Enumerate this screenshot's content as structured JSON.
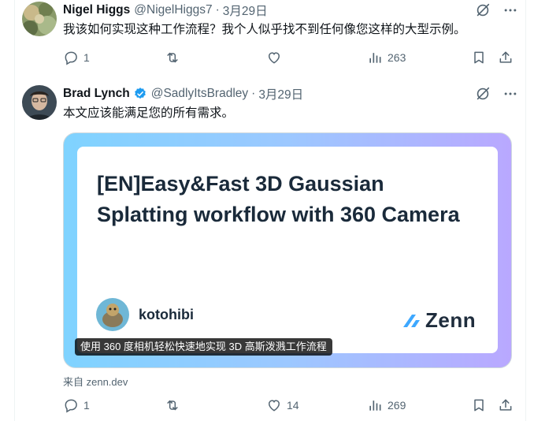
{
  "reply1": {
    "name": "Nigel Higgs",
    "handle": "@NigelHiggs7",
    "separator": "·",
    "date": "3月29日",
    "text": "我该如何实现这种工作流程？我个人似乎找不到任何像您这样的大型示例。",
    "actions": {
      "replies": "1",
      "retweets": "",
      "likes": "",
      "views": "263"
    }
  },
  "reply2": {
    "name": "Brad Lynch",
    "handle": "@SadlyItsBradley",
    "separator": "·",
    "date": "3月29日",
    "text": "本文应该能满足您的所有需求。",
    "card": {
      "title": "[EN]Easy&Fast 3D Gaussian Splatting workflow with 360 Camera",
      "author": "kotohibi",
      "brand": "Zenn",
      "caption": "使用 360 度相机轻松快速地实现 3D 高斯泼溅工作流程"
    },
    "source": "来自 zenn.dev",
    "actions": {
      "replies": "1",
      "retweets": "",
      "likes": "14",
      "views": "269"
    }
  },
  "colors": {
    "accent_verified": "#1d9bf0",
    "muted_text": "#536471",
    "primary_text": "#0f1419",
    "card_gradient_start": "#7fd3ff",
    "card_gradient_end": "#b9a8ff"
  },
  "icons": [
    "grok-icon",
    "more-icon",
    "reply-icon",
    "retweet-icon",
    "like-icon",
    "views-icon",
    "bookmark-icon",
    "share-icon",
    "verified-badge-icon"
  ]
}
